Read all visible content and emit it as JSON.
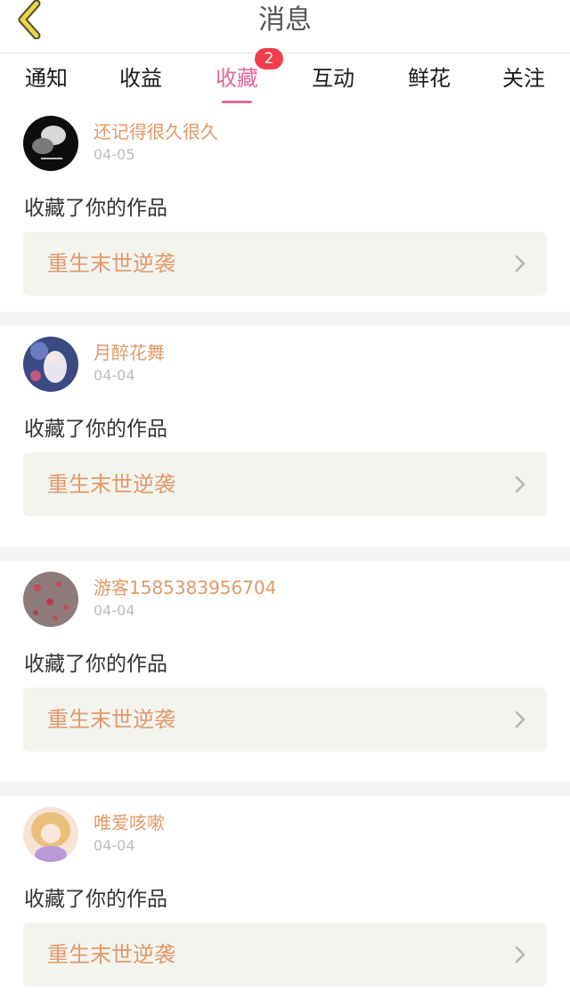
{
  "header": {
    "title": "消息"
  },
  "tabs": [
    {
      "label": "通知",
      "active": false
    },
    {
      "label": "收益",
      "active": false
    },
    {
      "label": "收藏",
      "active": true,
      "badge": "2"
    },
    {
      "label": "互动",
      "active": false
    },
    {
      "label": "鲜花",
      "active": false
    },
    {
      "label": "关注",
      "active": false
    }
  ],
  "messages": [
    {
      "username": "还记得很久很久",
      "date": "04-05",
      "action": "收藏了你的作品",
      "work_title": "重生末世逆袭"
    },
    {
      "username": "月醉花舞",
      "date": "04-04",
      "action": "收藏了你的作品",
      "work_title": "重生末世逆袭"
    },
    {
      "username": "游客1585383956704",
      "date": "04-04",
      "action": "收藏了你的作品",
      "work_title": "重生末世逆袭"
    },
    {
      "username": "唯爱咳嗽",
      "date": "04-04",
      "action": "收藏了你的作品",
      "work_title": "重生末世逆袭"
    }
  ],
  "colors": {
    "accent": "#e2679a",
    "badge": "#f23d4c",
    "username": "#e1996a",
    "back_icon": "#e6d64a"
  },
  "icons": {
    "back": "chevron-left-icon",
    "work_link": "chevron-right-icon"
  }
}
